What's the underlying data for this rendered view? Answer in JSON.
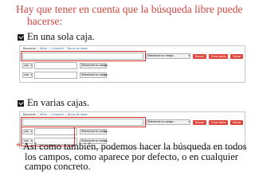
{
  "heading": "Hay que tener en cuenta que la búsqueda libre puede hacerse:",
  "bullets": [
    {
      "text": "En una sola caja."
    },
    {
      "text": "En varias cajas."
    }
  ],
  "search_ui": {
    "tabs": [
      "Buscando",
      "Niños",
      "Compartir",
      "Busca de datos"
    ],
    "field_select": "Seleccione un campo...",
    "op_values": [
      "",
      "AND",
      "AND"
    ],
    "buttons": {
      "search": "Buscar",
      "alert": "Crear alerta",
      "clear": "Borrar"
    }
  },
  "footer": {
    "marker": "*",
    "text": "Así como también, podemos hacer la búsqueda en todos los campos, como aparece por defecto, o en cualquier campo concreto."
  },
  "colors": {
    "accent": "#d1463f",
    "button": "#e0473c",
    "highlight": "#d32f2f"
  }
}
